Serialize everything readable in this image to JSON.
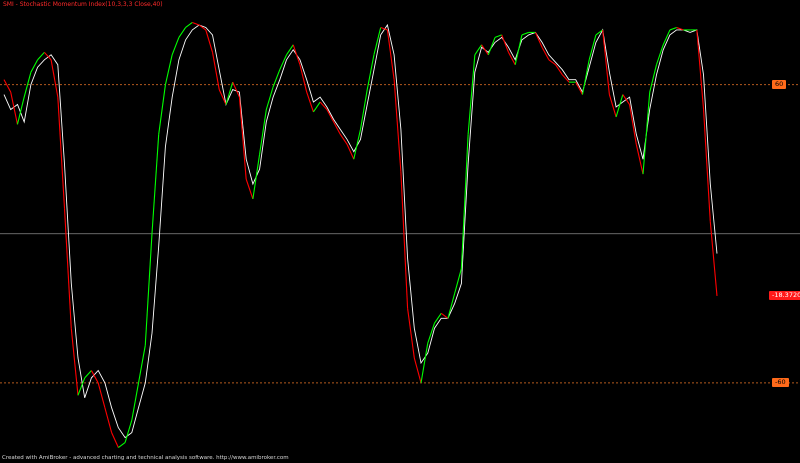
{
  "title": "SMI - Stochastic Momentum Index(10,3,3,3 Close,40)",
  "footer": "Created with AmiBroker - advanced charting and technical analysis software. http://www.amibroker.com",
  "colors": {
    "background": "#000000",
    "smi_line": "#ffffff",
    "signal_up": "#00ff00",
    "signal_down": "#ff0000",
    "upper_level_line": "#b45a1e",
    "lower_level_line": "#b45a1e",
    "mid_line": "#8a8a8a",
    "level_tag": "#ff6a1a",
    "value_tag": "#ff1a1a"
  },
  "chart_data": {
    "type": "line",
    "title": "SMI - Stochastic Momentum Index(10,3,3,3 Close,40)",
    "ylim": [
      -87,
      86
    ],
    "levels": [
      {
        "value": 60,
        "label": "60",
        "style": "dotted"
      },
      {
        "value": 0,
        "label": "",
        "style": "solid"
      },
      {
        "value": -60,
        "label": "-60",
        "style": "dotted"
      }
    ],
    "last_value_label": "-18.3720",
    "series": [
      {
        "values": [
          56,
          50,
          52,
          45,
          60,
          67,
          70,
          72,
          68,
          28,
          -20,
          -50,
          -66,
          -58,
          -55,
          -60,
          -70,
          -78,
          -82,
          -80,
          -70,
          -60,
          -40,
          -5,
          35,
          55,
          70,
          78,
          82,
          84,
          83,
          80,
          66,
          52,
          58,
          57,
          30,
          20,
          26,
          45,
          55,
          62,
          70,
          74,
          70,
          62,
          53,
          55,
          51,
          46,
          42,
          38,
          33,
          38,
          52,
          66,
          80,
          84,
          72,
          42,
          -10,
          -38,
          -52,
          -48,
          -38,
          -34,
          -34,
          -28,
          -20,
          28,
          65,
          75,
          73,
          77,
          79,
          75,
          70,
          78,
          80,
          81,
          77,
          72,
          69,
          66,
          62,
          62,
          57,
          67,
          77,
          82,
          65,
          51,
          53,
          55,
          40,
          30,
          50,
          64,
          74,
          80,
          82,
          82,
          81,
          82,
          64,
          20,
          -8
        ]
      },
      {
        "values": [
          62,
          57,
          44,
          55,
          65,
          70,
          73,
          70,
          55,
          10,
          -38,
          -65,
          -58,
          -55,
          -60,
          -70,
          -80,
          -86,
          -84,
          -75,
          -60,
          -45,
          0,
          40,
          60,
          72,
          79,
          83,
          85,
          84,
          82,
          73,
          58,
          52,
          61,
          55,
          22,
          14,
          32,
          50,
          59,
          66,
          72,
          76,
          68,
          57,
          49,
          53,
          50,
          45,
          40,
          36,
          30,
          42,
          58,
          72,
          83,
          82,
          62,
          25,
          -30,
          -50,
          -60,
          -44,
          -36,
          -32,
          -34,
          -24,
          -14,
          40,
          72,
          76,
          72,
          79,
          80,
          73,
          68,
          80,
          81,
          81,
          75,
          70,
          68,
          64,
          61,
          61,
          56,
          70,
          80,
          82,
          56,
          47,
          56,
          52,
          36,
          24,
          57,
          68,
          76,
          82,
          83,
          82,
          82,
          82,
          50,
          5,
          -25
        ]
      }
    ]
  }
}
